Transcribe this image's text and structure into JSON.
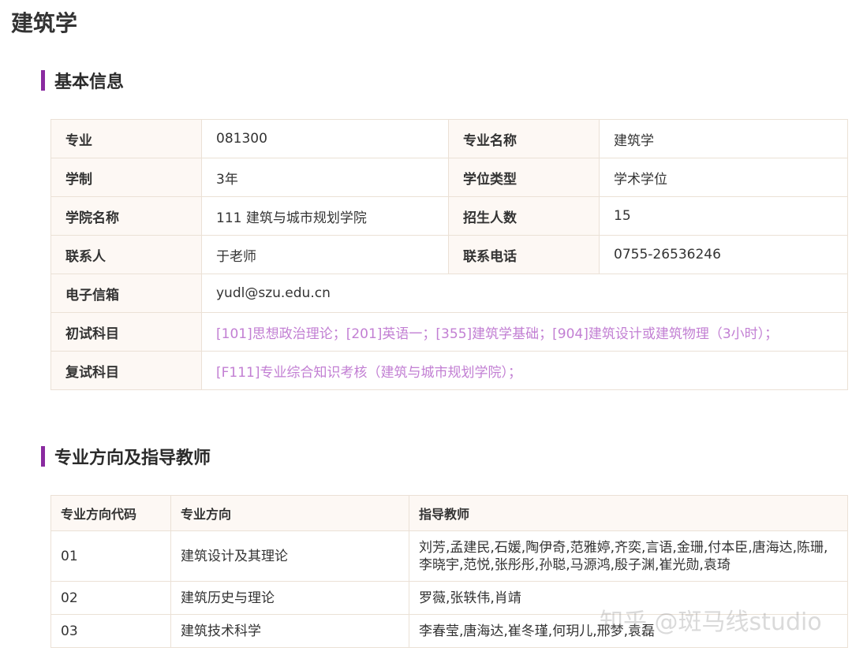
{
  "page_title": "建筑学",
  "basic_info": {
    "heading": "基本信息",
    "rows": [
      {
        "k1": "专业",
        "v1": "081300",
        "k2": "专业名称",
        "v2": "建筑学"
      },
      {
        "k1": "学制",
        "v1": "3年",
        "k2": "学位类型",
        "v2": "学术学位"
      },
      {
        "k1": "学院名称",
        "v1": "111 建筑与城市规划学院",
        "k2": "招生人数",
        "v2": "15"
      },
      {
        "k1": "联系人",
        "v1": "于老师",
        "k2": "联系电话",
        "v2": "0755-26536246"
      }
    ],
    "email_label": "电子信箱",
    "email": "yudl@szu.edu.cn",
    "first_exam_label": "初试科目",
    "first_exam": "[101]思想政治理论；[201]英语一；[355]建筑学基础；[904]建筑设计或建筑物理（3小时）；",
    "retest_label": "复试科目",
    "retest": "[F111]专业综合知识考核（建筑与城市规划学院）；"
  },
  "directions": {
    "heading": "专业方向及指导教师",
    "columns": [
      "专业方向代码",
      "专业方向",
      "指导教师"
    ],
    "rows": [
      {
        "code": "01",
        "name": "建筑设计及其理论",
        "teachers": "刘芳,孟建民,石媛,陶伊奇,范雅婷,齐奕,言语,金珊,付本臣,唐海达,陈珊,李晓宇,范悦,张彤彤,孙聪,马源鸿,殷子渊,崔光勋,袁琦"
      },
      {
        "code": "02",
        "name": "建筑历史与理论",
        "teachers": "罗薇,张轶伟,肖靖"
      },
      {
        "code": "03",
        "name": "建筑技术科学",
        "teachers": "李春莹,唐海达,崔冬瑾,何玥儿,邢梦,袁磊"
      }
    ]
  },
  "watermark": "知乎 @斑马线studio",
  "colors": {
    "accent_bar": "#8a2aa0",
    "link_text": "#c27fd3",
    "header_bg": "#fdf8f4",
    "border": "#ebe1d6"
  }
}
